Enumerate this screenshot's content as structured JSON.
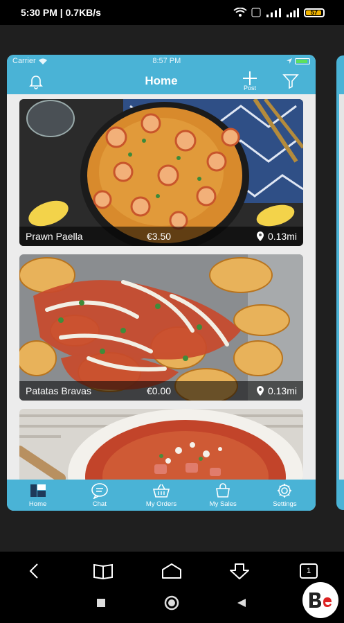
{
  "android_status": {
    "time_speed": "5:30 PM | 0.7KB/s",
    "battery": "57"
  },
  "ios_status": {
    "carrier": "Carrier",
    "time": "8:57 PM"
  },
  "header": {
    "title": "Home",
    "post_label": "Post"
  },
  "listings": [
    {
      "name": "Prawn Paella",
      "price": "€3.50",
      "distance": "0.13mi"
    },
    {
      "name": "Patatas Bravas",
      "price": "€0.00",
      "distance": "0.13mi"
    }
  ],
  "tabs": [
    {
      "label": "Home",
      "icon": "home-icon"
    },
    {
      "label": "Chat",
      "icon": "chat-icon"
    },
    {
      "label": "My Orders",
      "icon": "basket-icon"
    },
    {
      "label": "My Sales",
      "icon": "bag-icon"
    },
    {
      "label": "Settings",
      "icon": "gear-icon"
    }
  ],
  "browser_nav": {
    "tab_count": "1"
  },
  "colors": {
    "accent": "#4ab3d6",
    "background": "#ececec"
  }
}
